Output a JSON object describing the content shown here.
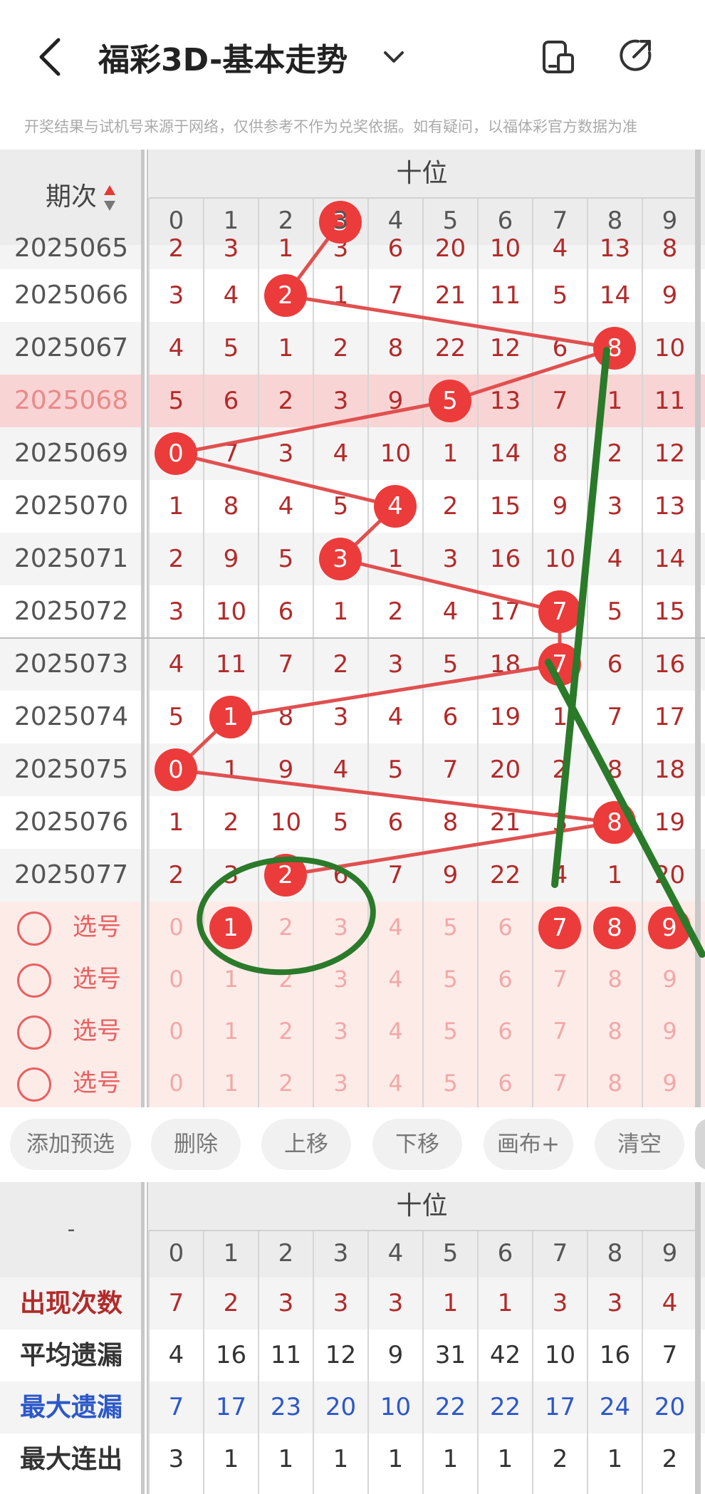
{
  "header": {
    "title": "福彩3D-基本走势",
    "disclaimer": "开奖结果与试机号来源于网络，仅供参考不作为兑奖依据。如有疑问，以福体彩官方数据为准"
  },
  "trend": {
    "group_label": "十位",
    "period_header": "期次",
    "digits": [
      "0",
      "1",
      "2",
      "3",
      "4",
      "5",
      "6",
      "7",
      "8",
      "9"
    ],
    "partial_row": [
      "2025065",
      "2",
      "3",
      "1",
      "3",
      "6",
      "20",
      "10",
      "4",
      "13",
      "8"
    ],
    "rows": [
      {
        "period": "2025066",
        "cells": [
          "3",
          "4",
          "2",
          "1",
          "7",
          "21",
          "11",
          "5",
          "14",
          "9"
        ],
        "hit": 2
      },
      {
        "period": "2025067",
        "cells": [
          "4",
          "5",
          "1",
          "2",
          "8",
          "22",
          "12",
          "6",
          "8",
          "10"
        ],
        "hit": 8
      },
      {
        "period": "2025068",
        "cells": [
          "5",
          "6",
          "2",
          "3",
          "9",
          "5",
          "13",
          "7",
          "1",
          "11"
        ],
        "hit": 5
      },
      {
        "period": "2025069",
        "cells": [
          "0",
          "7",
          "3",
          "4",
          "10",
          "1",
          "14",
          "8",
          "2",
          "12"
        ],
        "hit": 0
      },
      {
        "period": "2025070",
        "cells": [
          "1",
          "8",
          "4",
          "5",
          "4",
          "2",
          "15",
          "9",
          "3",
          "13"
        ],
        "hit": 4
      },
      {
        "period": "2025071",
        "cells": [
          "2",
          "9",
          "5",
          "3",
          "1",
          "3",
          "16",
          "10",
          "4",
          "14"
        ],
        "hit": 3
      },
      {
        "period": "2025072",
        "cells": [
          "3",
          "10",
          "6",
          "1",
          "2",
          "4",
          "17",
          "7",
          "5",
          "15"
        ],
        "hit": 7
      },
      {
        "period": "2025073",
        "cells": [
          "4",
          "11",
          "7",
          "2",
          "3",
          "5",
          "18",
          "7",
          "6",
          "16"
        ],
        "hit": 7
      },
      {
        "period": "2025074",
        "cells": [
          "5",
          "1",
          "8",
          "3",
          "4",
          "6",
          "19",
          "1",
          "7",
          "17"
        ],
        "hit": 1
      },
      {
        "period": "2025075",
        "cells": [
          "0",
          "1",
          "9",
          "4",
          "5",
          "7",
          "20",
          "2",
          "8",
          "18"
        ],
        "hit": 0
      },
      {
        "period": "2025076",
        "cells": [
          "1",
          "2",
          "10",
          "5",
          "6",
          "8",
          "21",
          "3",
          "8",
          "19"
        ],
        "hit": 8
      },
      {
        "period": "2025077",
        "cells": [
          "2",
          "3",
          "2",
          "6",
          "7",
          "9",
          "22",
          "4",
          "1",
          "20"
        ],
        "hit": 2
      }
    ],
    "select_label": "选号",
    "select_rows": [
      {
        "selected": [
          1,
          7,
          8,
          9
        ]
      },
      {
        "selected": []
      },
      {
        "selected": []
      },
      {
        "selected": []
      }
    ]
  },
  "buttons": [
    "添加预选",
    "删除",
    "上移",
    "下移",
    "画布+",
    "清空"
  ],
  "stats": {
    "group_label": "十位",
    "corner_label": "-",
    "rows": [
      {
        "label": "出现次数",
        "values": [
          "7",
          "2",
          "3",
          "3",
          "3",
          "1",
          "1",
          "3",
          "3",
          "4"
        ],
        "color": "#b22a2a"
      },
      {
        "label": "平均遗漏",
        "values": [
          "4",
          "16",
          "11",
          "12",
          "9",
          "31",
          "42",
          "10",
          "16",
          "7"
        ],
        "color": "#333333"
      },
      {
        "label": "最大遗漏",
        "values": [
          "7",
          "17",
          "23",
          "20",
          "10",
          "22",
          "22",
          "17",
          "24",
          "20"
        ],
        "color": "#2c58c8"
      },
      {
        "label": "最大连出",
        "values": [
          "3",
          "1",
          "1",
          "1",
          "1",
          "1",
          "1",
          "2",
          "1",
          "2"
        ],
        "color": "#333333"
      }
    ]
  },
  "colors": {
    "ball": "#ec3b3b",
    "line": "#e05050",
    "annotation": "#2a7a2a",
    "highlight_row": "#f9d4d4",
    "select_bg": "#fdebe8"
  }
}
